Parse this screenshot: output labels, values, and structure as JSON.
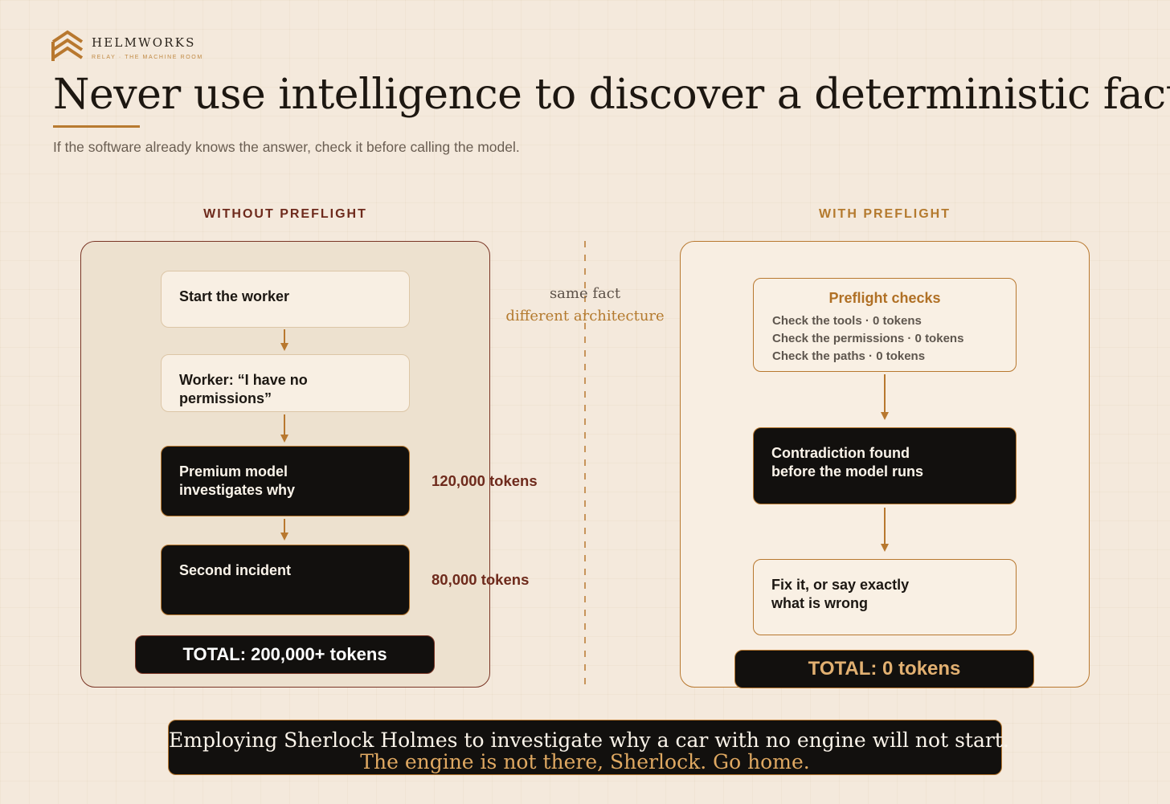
{
  "brand": {
    "name": "HELMWORKS",
    "tagline": "RELAY · THE MACHINE ROOM",
    "logo_icon": "stacked-chevron-logo-icon"
  },
  "title": "Never use intelligence to discover a deterministic fact",
  "subtitle": "If the software already knows the answer, check it before calling the model.",
  "colors": {
    "background": "#f4e9dc",
    "accent": "#b8782f",
    "danger": "#6e2a1c",
    "dark_node": "#12100e",
    "gold_text": "#e0a962"
  },
  "without": {
    "heading": "WITHOUT PREFLIGHT",
    "steps": [
      {
        "label": "Start the worker",
        "style": "light"
      },
      {
        "label": "Worker: “I have no permissions”",
        "style": "light"
      },
      {
        "label": "Premium model investigates why",
        "style": "dark",
        "tokens": "120,000 tokens"
      },
      {
        "label": "Second incident",
        "style": "dark",
        "tokens": "80,000 tokens"
      }
    ],
    "total": "TOTAL: 200,000+ tokens"
  },
  "divider": {
    "line1": "same fact",
    "line2": "different architecture"
  },
  "with": {
    "heading": "WITH PREFLIGHT",
    "preflight": {
      "title": "Preflight checks",
      "checks": [
        "Check the tools · 0 tokens",
        "Check the permissions · 0 tokens",
        "Check the paths · 0 tokens"
      ]
    },
    "steps": [
      {
        "label": "Contradiction found before the model runs",
        "style": "dark"
      },
      {
        "label": "Fix it, or say exactly what is wrong",
        "style": "light"
      }
    ],
    "total": "TOTAL: 0 tokens"
  },
  "quote": {
    "line1": "Employing Sherlock Holmes to investigate why a car with no engine will not start.",
    "line2": "The engine is not there, Sherlock. Go home."
  }
}
